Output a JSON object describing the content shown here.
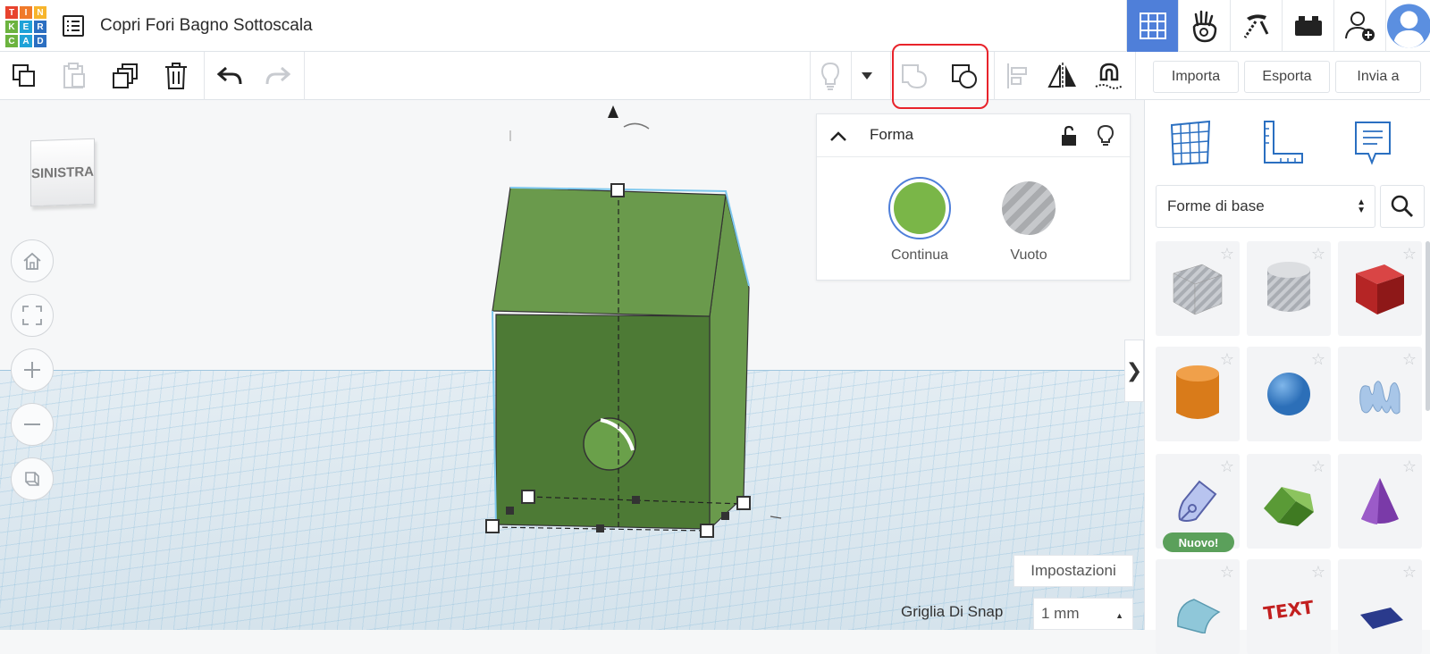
{
  "app": {
    "logo_letters": [
      "T",
      "I",
      "N",
      "K",
      "E",
      "R",
      "C",
      "A",
      "D"
    ],
    "logo_colors": [
      "#e8432e",
      "#f07a2a",
      "#f7b52c",
      "#6cb33f",
      "#1fa2d8",
      "#2c6fc1",
      "#6cb33f",
      "#1fa2d8",
      "#2c6fc1"
    ],
    "project_title": "Copri Fori Bagno Sottoscala"
  },
  "top_right_icons": [
    "3d-grid-view-icon",
    "circuits-hand-icon",
    "minecraft-pickaxe-icon",
    "bricks-icon",
    "invite-user-icon",
    "user-avatar"
  ],
  "toolbar": {
    "left_icons": [
      "copy-icon",
      "paste-icon",
      "duplicate-icon",
      "delete-icon",
      "undo-icon",
      "redo-icon"
    ],
    "right_icons": [
      "light-bulb-icon",
      "group-icon",
      "ungroup-icon",
      "align-icon",
      "mirror-icon",
      "cruise-magnet-icon"
    ],
    "import_label": "Importa",
    "export_label": "Esporta",
    "send_label": "Invia a"
  },
  "viewcube": {
    "face_label": "SINISTRA"
  },
  "shape_panel": {
    "title": "Forma",
    "solid_label": "Continua",
    "hole_label": "Vuoto",
    "solid_color": "#7ab648",
    "accent_ring": "#4f7fd9"
  },
  "sidebar": {
    "category": "Forme di base",
    "shapes": [
      {
        "name": "box-hole"
      },
      {
        "name": "cylinder-hole"
      },
      {
        "name": "box"
      },
      {
        "name": "cylinder"
      },
      {
        "name": "sphere"
      },
      {
        "name": "scribble"
      },
      {
        "name": "shape-generator",
        "badge": "Nuovo!"
      },
      {
        "name": "roof"
      },
      {
        "name": "cone"
      },
      {
        "name": "half-cylinder"
      },
      {
        "name": "text"
      },
      {
        "name": "polygon"
      }
    ]
  },
  "workplane": {
    "settings_label": "Impostazioni",
    "snap_grid_label": "Griglia Di Snap",
    "snap_value": "1 mm"
  },
  "model": {
    "color": "#5e8d44",
    "roof_color": "#6a9a4c",
    "side_color": "#4d7a35"
  }
}
